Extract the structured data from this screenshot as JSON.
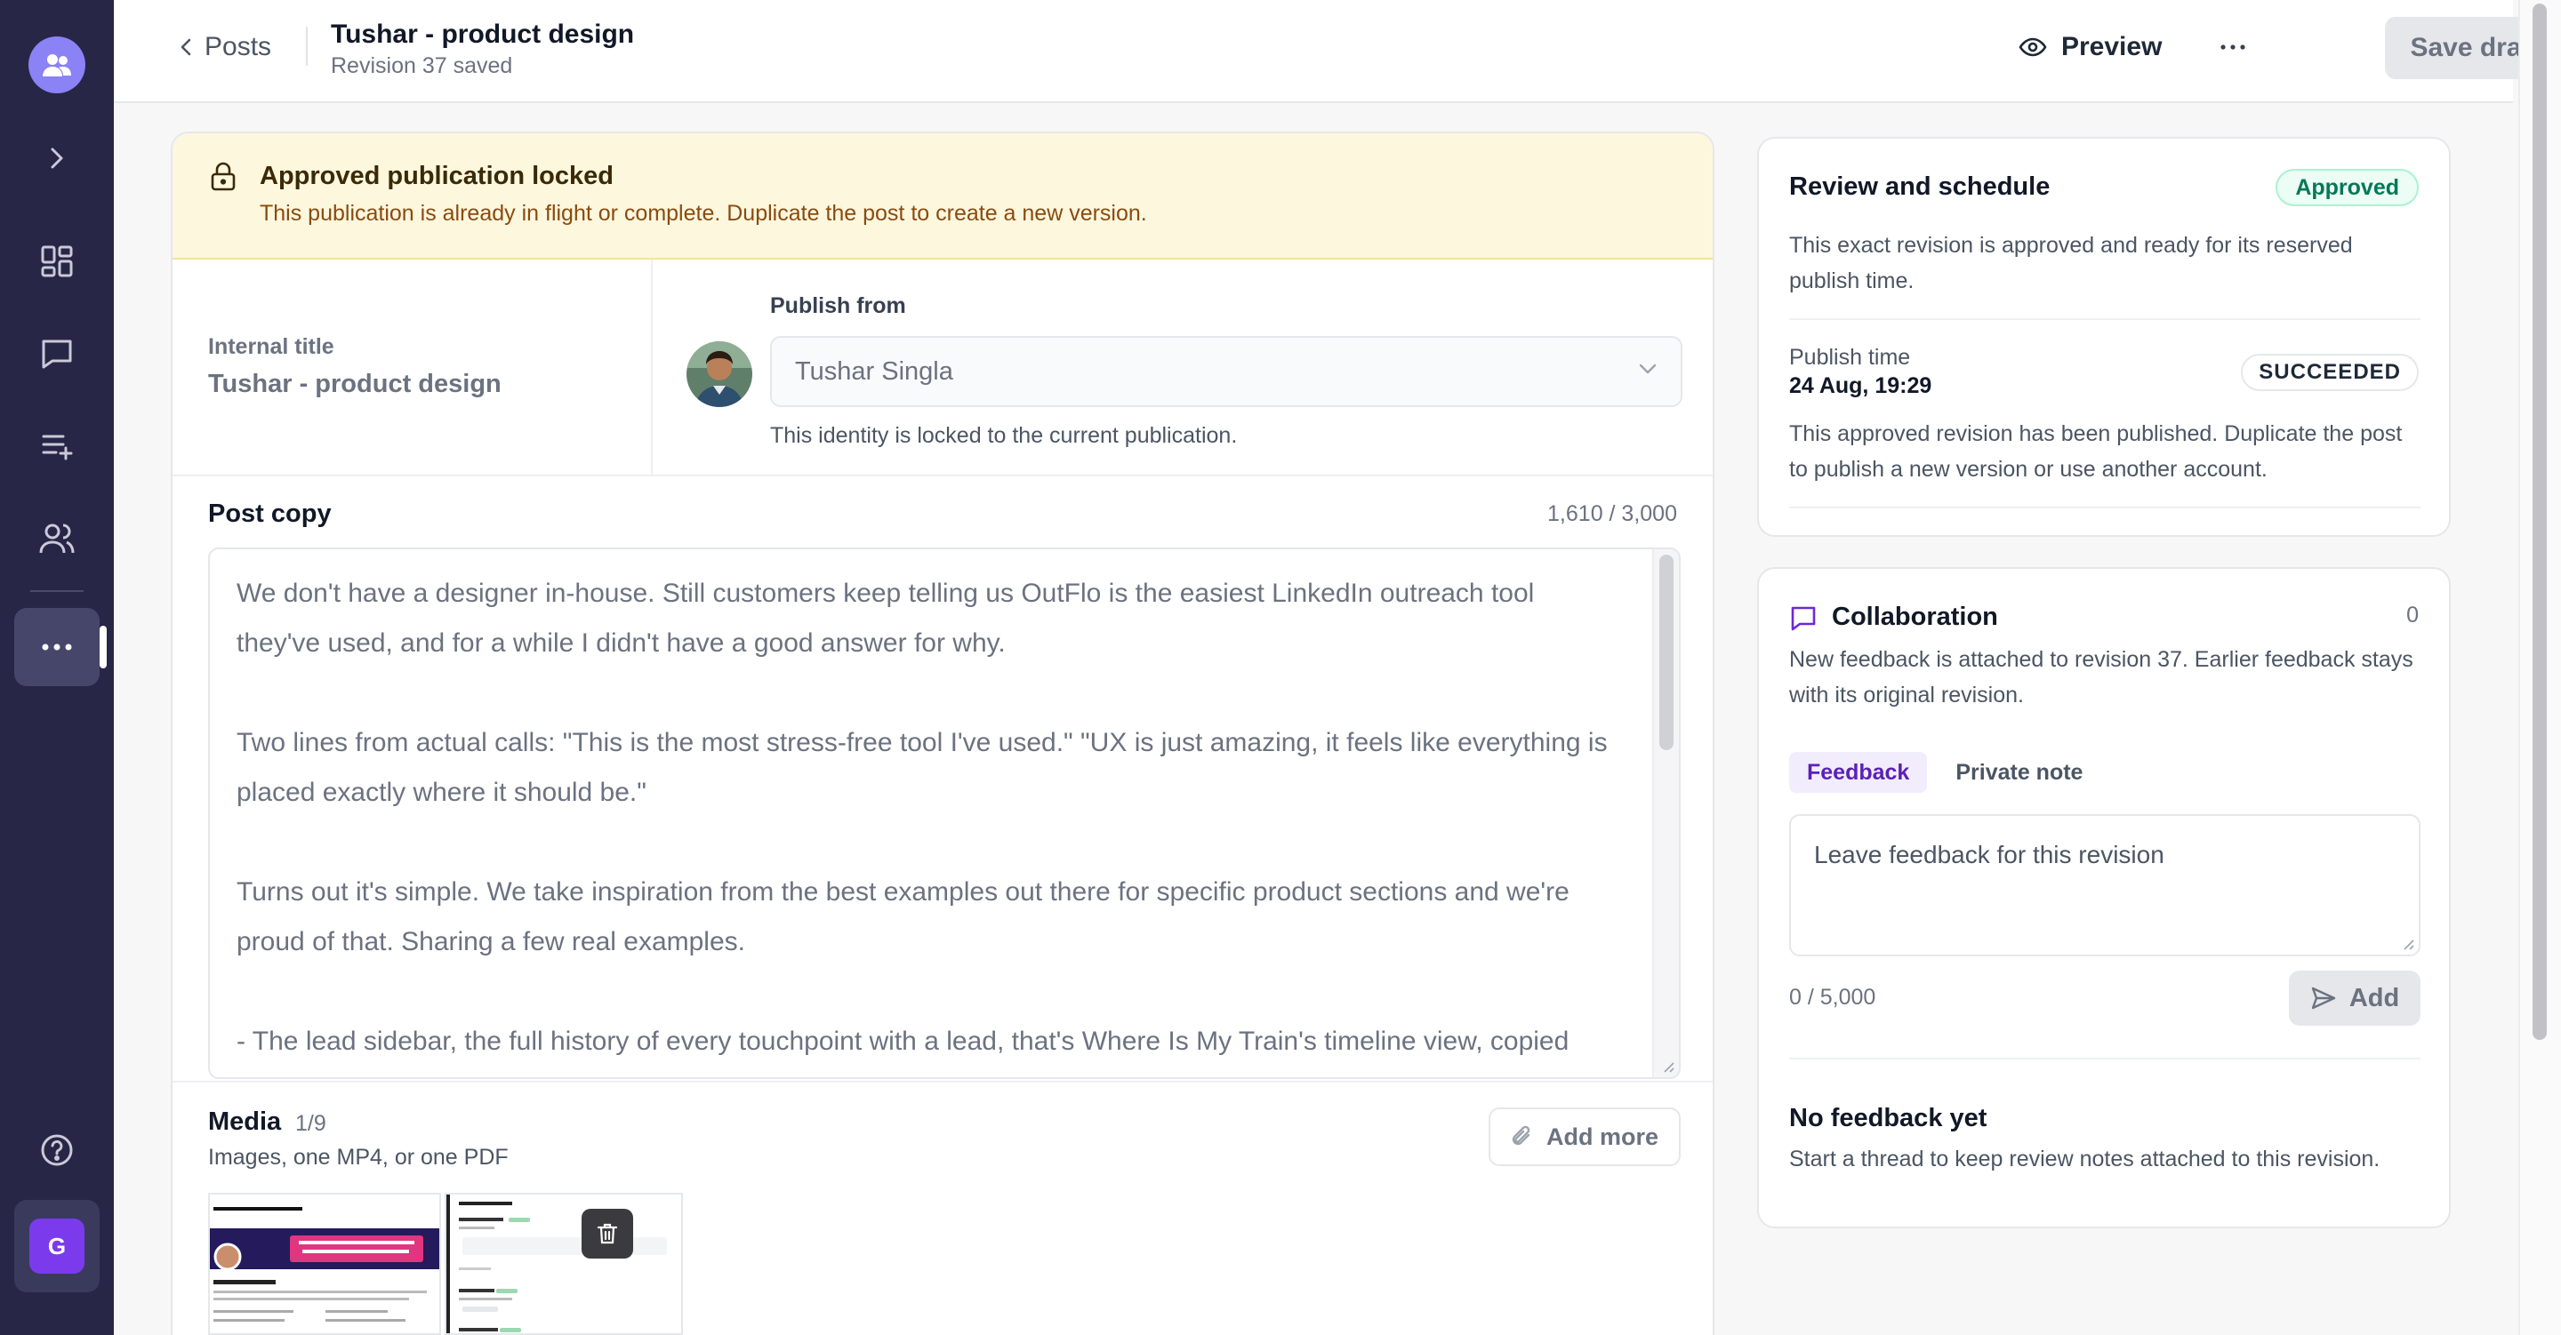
{
  "header": {
    "back_label": "Posts",
    "title": "Tushar - product design",
    "subtitle": "Revision 37 saved",
    "preview_label": "Preview",
    "save_label": "Save draft"
  },
  "rail": {
    "items": [
      "workspace-icon",
      "expand-icon",
      "dashboard-icon",
      "messages-icon",
      "queue-icon",
      "contacts-icon",
      "more-icon",
      "help-icon"
    ],
    "account_initial": "G"
  },
  "banner": {
    "title": "Approved publication locked",
    "description": "This publication is already in flight or complete. Duplicate the post to create a new version."
  },
  "meta": {
    "internal_title_label": "Internal title",
    "internal_title_value": "Tushar - product design",
    "publish_from_label": "Publish from",
    "publish_from_value": "Tushar Singla",
    "publish_from_hint": "This identity is locked to the current publication."
  },
  "post_copy": {
    "label": "Post copy",
    "count": "1,610 / 3,000",
    "text": "We don't have a designer in-house. Still customers keep telling us OutFlo is the easiest LinkedIn outreach tool they've used, and for a while I didn't have a good answer for why.\n\nTwo lines from actual calls: \"This is the most stress-free tool I've used.\" \"UX is just amazing, it feels like everything is placed exactly where it should be.\"\n\nTurns out it's simple. We take inspiration from the best examples out there for specific product sections and we're proud of that. Sharing a few real examples.\n\n- The lead sidebar, the full history of every touchpoint with a lead, that's Where Is My Train's timeline view, copied"
  },
  "media": {
    "title": "Media",
    "count": "1/9",
    "subtitle": "Images, one MP4, or one PDF",
    "add_more_label": "Add more"
  },
  "review": {
    "title": "Review and schedule",
    "status_badge": "Approved",
    "description": "This exact revision is approved and ready for its reserved publish time.",
    "publish_time_label": "Publish time",
    "publish_time_value": "24 Aug, 19:29",
    "publish_status": "SUCCEEDED",
    "note": "This approved revision has been published. Duplicate the post to publish a new version or use another account."
  },
  "collaboration": {
    "title": "Collaboration",
    "count": "0",
    "description": "New feedback is attached to revision 37. Earlier feedback stays with its original revision.",
    "tabs": [
      "Feedback",
      "Private note"
    ],
    "placeholder": "Leave feedback for this revision",
    "char_count": "0 / 5,000",
    "add_label": "Add",
    "empty_title": "No feedback yet",
    "empty_desc": "Start a thread to keep review notes attached to this revision."
  },
  "colors": {
    "rail_bg": "#272646",
    "accent": "#7c3aed",
    "banner_bg": "#fdf7de",
    "approved": "#047857"
  }
}
